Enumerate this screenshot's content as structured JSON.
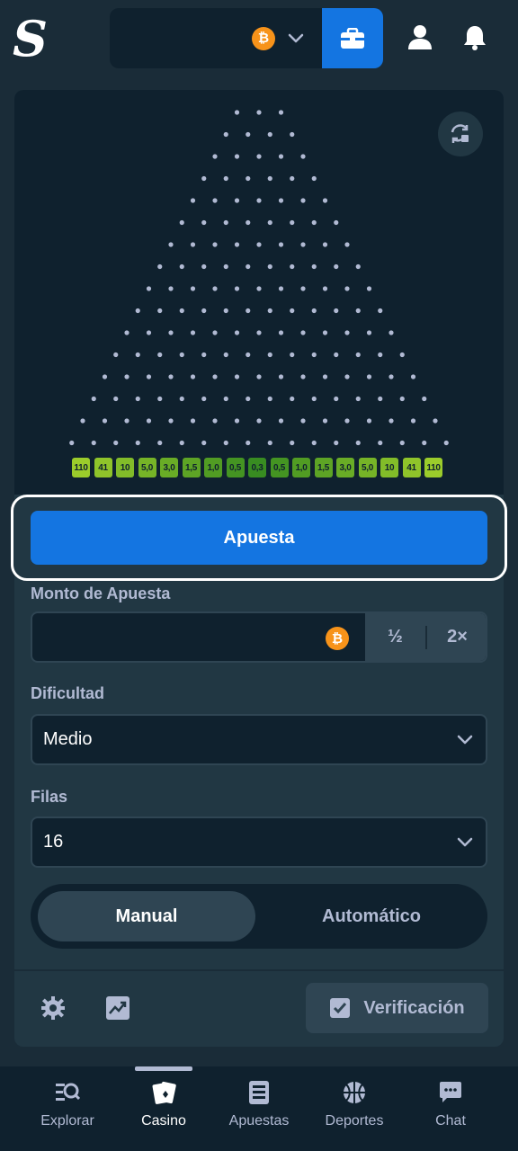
{
  "header": {
    "logo_letter": "S",
    "currency_icon": "bitcoin-icon",
    "currency_symbol": "₿"
  },
  "game": {
    "rows": 16,
    "multipliers": [
      "110",
      "41",
      "10",
      "5,0",
      "3,0",
      "1,5",
      "1,0",
      "0,5",
      "0,3",
      "0,5",
      "1,0",
      "1,5",
      "3,0",
      "5,0",
      "10",
      "41",
      "110"
    ],
    "multiplier_colors": [
      "#9bcc2b",
      "#8fc42a",
      "#82bc29",
      "#76b427",
      "#69ac26",
      "#5da425",
      "#519c23",
      "#449422",
      "#388c21",
      "#449422",
      "#519c23",
      "#5da425",
      "#69ac26",
      "#76b427",
      "#82bc29",
      "#8fc42a",
      "#9bcc2b"
    ]
  },
  "bet_button": {
    "label": "Apuesta"
  },
  "bet_amount": {
    "label": "Monto de Apuesta",
    "value": "",
    "currency_symbol": "₿",
    "half_label": "½",
    "double_label": "2×"
  },
  "difficulty": {
    "label": "Dificultad",
    "value": "Medio"
  },
  "rows_select": {
    "label": "Filas",
    "value": "16"
  },
  "mode": {
    "manual_label": "Manual",
    "auto_label": "Automático",
    "selected": "manual"
  },
  "footer": {
    "verify_label": "Verificación"
  },
  "bottom_nav": {
    "items": [
      {
        "label": "Explorar",
        "icon": "explore-icon"
      },
      {
        "label": "Casino",
        "icon": "casino-cards-icon"
      },
      {
        "label": "Apuestas",
        "icon": "bets-list-icon"
      },
      {
        "label": "Deportes",
        "icon": "basketball-icon"
      },
      {
        "label": "Chat",
        "icon": "chat-icon"
      }
    ],
    "active": 1
  },
  "colors": {
    "background": "#1a2c38",
    "panel": "#213743",
    "board": "#0f212e",
    "accent_blue": "#1475e1",
    "bitcoin": "#f7931a"
  }
}
